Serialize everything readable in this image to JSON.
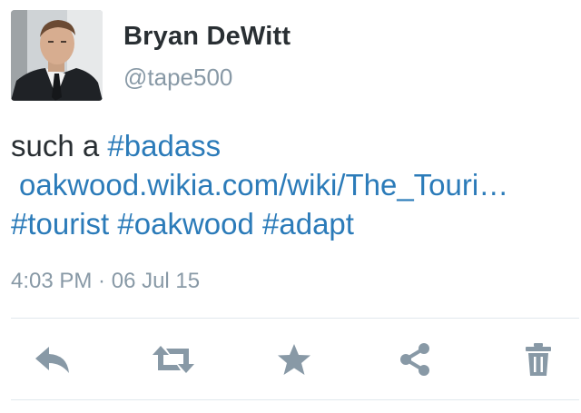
{
  "user": {
    "name": "Bryan DeWitt",
    "handle": "@tape500"
  },
  "tweet": {
    "lead_text": "such a ",
    "tag_badass": "#badass",
    "link": "oakwood.wikia.com/wiki/The_Touri…",
    "tag_tourist": "#tourist",
    "tag_oakwood": "#oakwood",
    "tag_adapt": "#adapt",
    "space": " "
  },
  "meta": {
    "time": "4:03 PM",
    "separator": " · ",
    "date": "06 Jul 15"
  },
  "actions": {
    "icons": [
      "reply-icon",
      "retweet-icon",
      "favorite-icon",
      "share-icon",
      "delete-icon"
    ],
    "icon_color": "#8899a6"
  },
  "colors": {
    "link": "#2b7bb9",
    "text": "#292f33",
    "secondary": "#8899a6",
    "divider": "#e1e8ed"
  }
}
